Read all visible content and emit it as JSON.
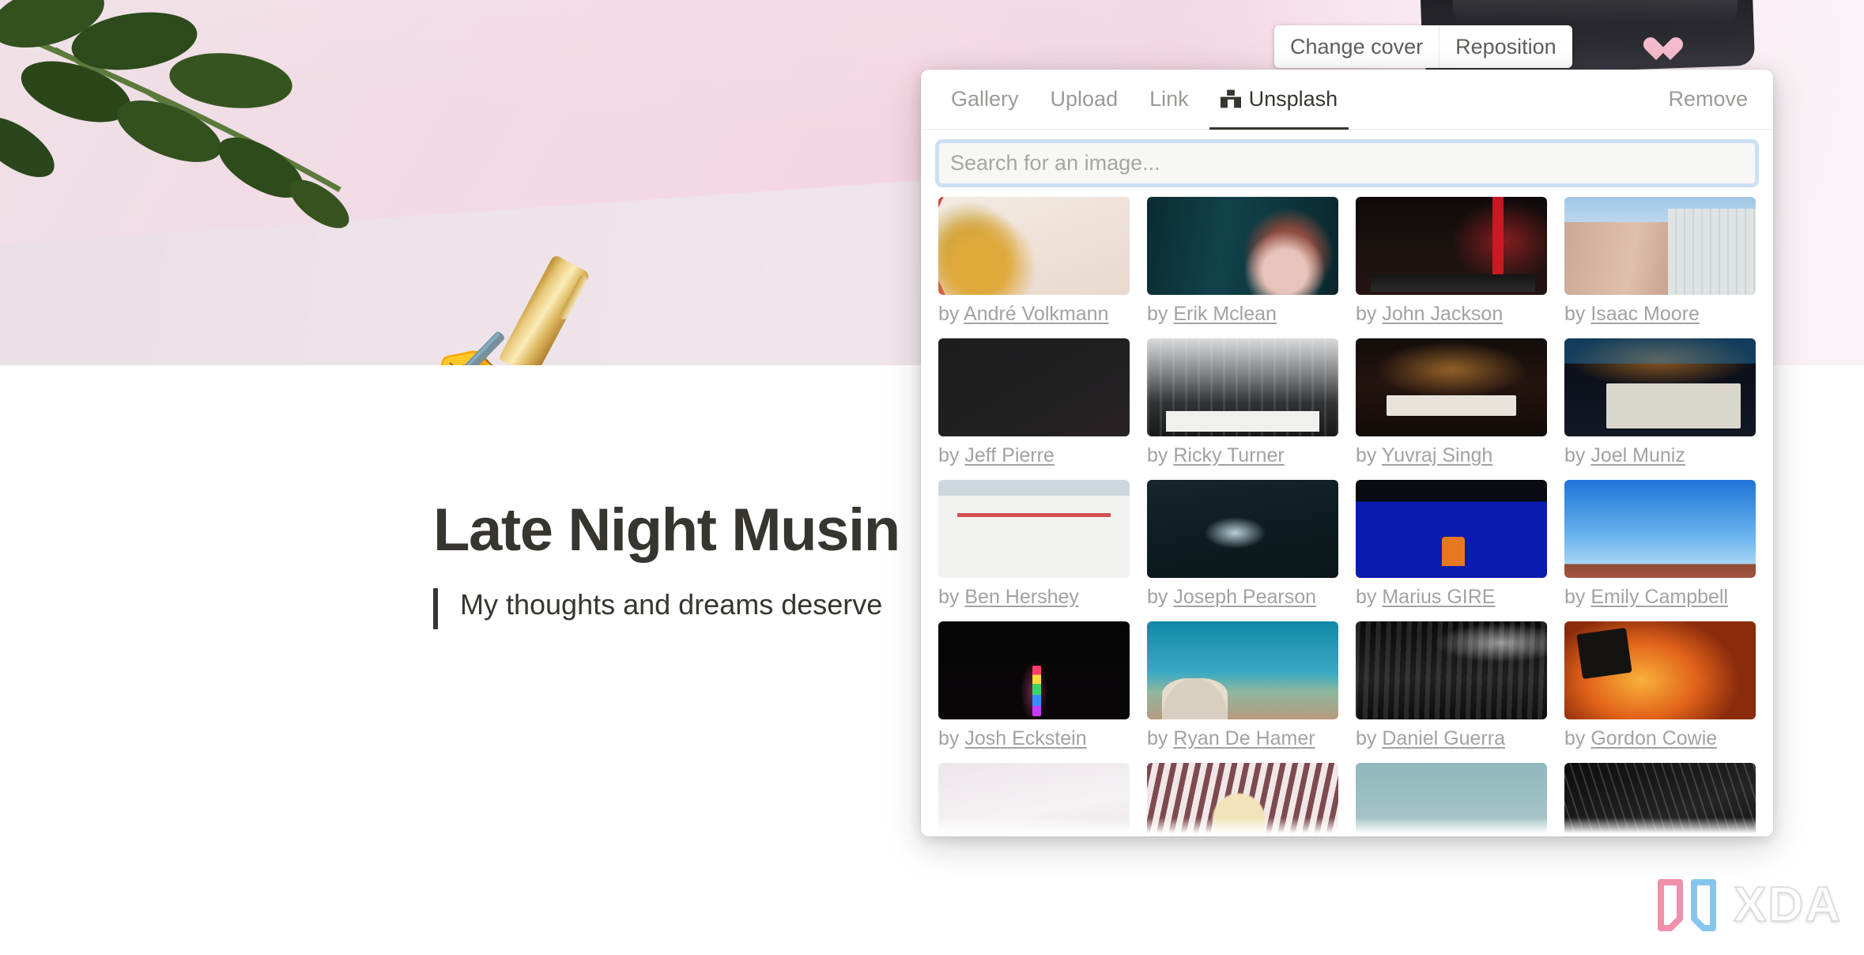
{
  "cover": {
    "actions": [
      {
        "label": "Change cover",
        "name": "change-cover-button"
      },
      {
        "label": "Reposition",
        "name": "reposition-button"
      }
    ]
  },
  "page": {
    "title": "Late Night Musin",
    "subtitle": "My thoughts and dreams deserve"
  },
  "picker": {
    "tabs": [
      {
        "label": "Gallery",
        "active": false
      },
      {
        "label": "Upload",
        "active": false
      },
      {
        "label": "Link",
        "active": false
      },
      {
        "label": "Unsplash",
        "active": true
      }
    ],
    "remove_label": "Remove",
    "search": {
      "value": "",
      "placeholder": "Search for an image..."
    },
    "credit_prefix": "by ",
    "results": [
      {
        "author": "André Volkmann",
        "art": "t-gauntlet"
      },
      {
        "author": "Erik Mclean",
        "art": "t-doll"
      },
      {
        "author": "John Jackson",
        "art": "t-fox"
      },
      {
        "author": "Isaac Moore",
        "art": "t-cinema"
      },
      {
        "author": "Jeff Pierre",
        "art": "t-black"
      },
      {
        "author": "Ricky Turner",
        "art": "t-bw-theatre"
      },
      {
        "author": "Yuvraj Singh",
        "art": "t-chicago"
      },
      {
        "author": "Joel Muniz",
        "art": "t-ua"
      },
      {
        "author": "Ben Hershey",
        "art": "t-closed"
      },
      {
        "author": "Joseph Pearson",
        "art": "t-dark-room"
      },
      {
        "author": "Marius GIRE",
        "art": "t-blue-seats"
      },
      {
        "author": "Emily Campbell",
        "art": "t-desert"
      },
      {
        "author": "Josh Eckstein",
        "art": "t-regal"
      },
      {
        "author": "Ryan De Hamer",
        "art": "t-dome"
      },
      {
        "author": "Daniel Guerra",
        "art": "t-audience"
      },
      {
        "author": "Gordon Cowie",
        "art": "t-fire"
      },
      {
        "author": "",
        "art": "t-pale"
      },
      {
        "author": "",
        "art": "t-popcorn"
      },
      {
        "author": "",
        "art": "t-pool"
      },
      {
        "author": "",
        "art": "t-bw-tree"
      }
    ]
  },
  "watermark": {
    "text": "XDA"
  },
  "colors": {
    "accent_text": "#37352f",
    "muted_text": "#9b9a97",
    "focus_ring": "#a0c4eb",
    "panel_bg": "#ffffff",
    "cover_pink": "#f3d3e2",
    "xda_pink": "#f08ba5",
    "xda_blue": "#7fc4ee"
  }
}
